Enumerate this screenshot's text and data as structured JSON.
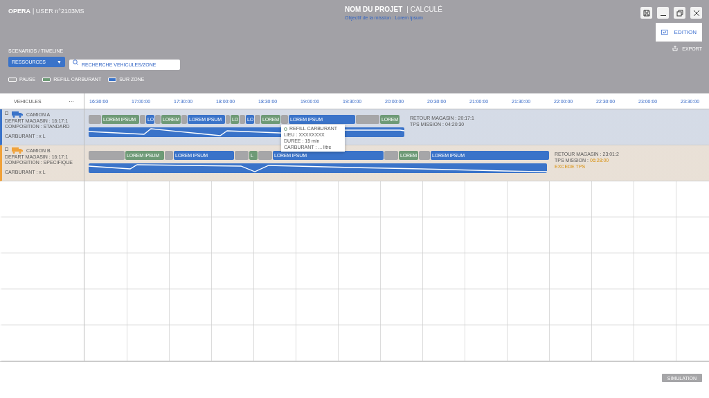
{
  "app": {
    "name": "OPERA",
    "user": "| USER n°2103MS"
  },
  "project": {
    "title": "NOM DU PROJET",
    "status": "| CALCULÉ",
    "subtitle": "Objectif de la mission : Lorem ipsum"
  },
  "actions": {
    "edit": "EDITION",
    "export": "EXPORT"
  },
  "breadcrumb": "SCENARIOS / TIMELINE",
  "dropdown": {
    "value": "RESSOURCES",
    "arrow": "▼"
  },
  "search": {
    "placeholder": "RECHERCHE VEHICULES/ZONE"
  },
  "legend": [
    {
      "kind": "pause",
      "label": "PAUSE"
    },
    {
      "kind": "refill",
      "label": "REFILL CARBURANT"
    },
    {
      "kind": "zone",
      "label": "SUR ZONE"
    }
  ],
  "table": {
    "header": "VEHICULES",
    "more": "···",
    "times": [
      "16:30:00",
      "17:00:00",
      "17:30:00",
      "18:00:00",
      "18:30:00",
      "19:00:00",
      "19:30:00",
      "20:00:00",
      "20:30:00",
      "21:00:00",
      "21:30:00",
      "22:00:00",
      "22:30:00",
      "23:00:00",
      "23:30:00"
    ],
    "vehicles": [
      {
        "name": "CAMION A",
        "color": "#3a73c9",
        "checked": false,
        "depart": "DEPART MAGASIN : 16:17:1",
        "composition": "COMPOSITION : STANDARD",
        "fuel": "CARBURANT : x L",
        "return": "RETOUR MAGASIN : 20:17:1",
        "mission_label": "TPS MISSION :",
        "mission_value": "04:20:30",
        "mission_late": false,
        "segments": [
          {
            "kind": "pause"
          },
          {
            "kind": "refill",
            "label": "LOREM IPSUM"
          },
          {
            "kind": "pause"
          },
          {
            "kind": "zone",
            "label": "LO"
          },
          {
            "kind": "pause"
          },
          {
            "kind": "refill",
            "label": "LOREM"
          },
          {
            "kind": "pause"
          },
          {
            "kind": "zone",
            "label": "LOREM IPSUM"
          },
          {
            "kind": "pause"
          },
          {
            "kind": "refill",
            "label": "LO"
          },
          {
            "kind": "pause"
          },
          {
            "kind": "zone",
            "label": "LO"
          },
          {
            "kind": "pause"
          },
          {
            "kind": "refill",
            "label": "LOREM"
          },
          {
            "kind": "pause"
          },
          {
            "kind": "zone",
            "label": "LOREM IPSUM"
          },
          {
            "kind": "pause"
          },
          {
            "kind": "refill",
            "label": "LOREM"
          }
        ],
        "tooltip": {
          "title": "REFILL CARBURANT",
          "lines": [
            "LIEU : XXXXXXXX",
            "DUREE : 15 min",
            "CARBURANT : ... litre"
          ]
        }
      },
      {
        "name": "CAMION B",
        "color": "#f0a23a",
        "checked": false,
        "depart": "DEPART MAGASIN : 16:17:1",
        "composition": "COMPOSITION : SPECIFIQUE",
        "fuel": "CARBURANT : x L",
        "return": "RETOUR MAGASIN : 23:01:2",
        "mission_label": "TPS MISSION :",
        "mission_value": "06:28:00",
        "mission_late": true,
        "warning": "EXCEDE TPS",
        "segments": [
          {
            "kind": "pause"
          },
          {
            "kind": "refill",
            "label": "LOREM IPSUM"
          },
          {
            "kind": "pause"
          },
          {
            "kind": "zone",
            "label": "LOREM IPSUM"
          },
          {
            "kind": "pause"
          },
          {
            "kind": "refill",
            "label": "L"
          },
          {
            "kind": "pause"
          },
          {
            "kind": "zone",
            "label": "LOREM IPSUM"
          },
          {
            "kind": "pause"
          },
          {
            "kind": "refill",
            "label": "LOREM"
          },
          {
            "kind": "pause"
          },
          {
            "kind": "zone",
            "label": "LOREM IPSUM"
          }
        ]
      }
    ]
  },
  "footer": {
    "button": "SIMULATION"
  }
}
